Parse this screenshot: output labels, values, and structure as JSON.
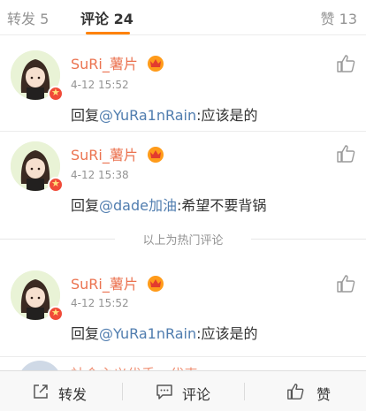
{
  "tabs": {
    "repost_label": "转发 5",
    "comments_label": "评论 24",
    "likes_label": "赞 13"
  },
  "hot_divider_label": "以上为热门评论",
  "comments": [
    {
      "username": "SuRi_薯片",
      "time": "4-12 15:52",
      "reply_prefix": "回复",
      "mention": "@YuRa1nRain",
      "text": ":应该是的"
    },
    {
      "username": "SuRi_薯片",
      "time": "4-12 15:38",
      "reply_prefix": "回复",
      "mention": "@dade加油",
      "text": ":希望不要背锅"
    },
    {
      "username": "SuRi_薯片",
      "time": "4-12 15:52",
      "reply_prefix": "回复",
      "mention": "@YuRa1nRain",
      "text": ":应该是的"
    }
  ],
  "partial_comment": {
    "username": "社会主义优秀…代表"
  },
  "bottom_bar": {
    "repost_label": "转发",
    "comment_label": "评论",
    "like_label": "赞"
  },
  "colors": {
    "accent": "#ff8200",
    "username": "#eb7350",
    "mention": "#507daf",
    "muted": "#939393"
  },
  "icons": {
    "like": "thumbs-up-icon",
    "repost": "share-icon",
    "comment": "chat-bubble-icon",
    "level": "crown-level-icon",
    "badge": "star-badge-icon"
  }
}
